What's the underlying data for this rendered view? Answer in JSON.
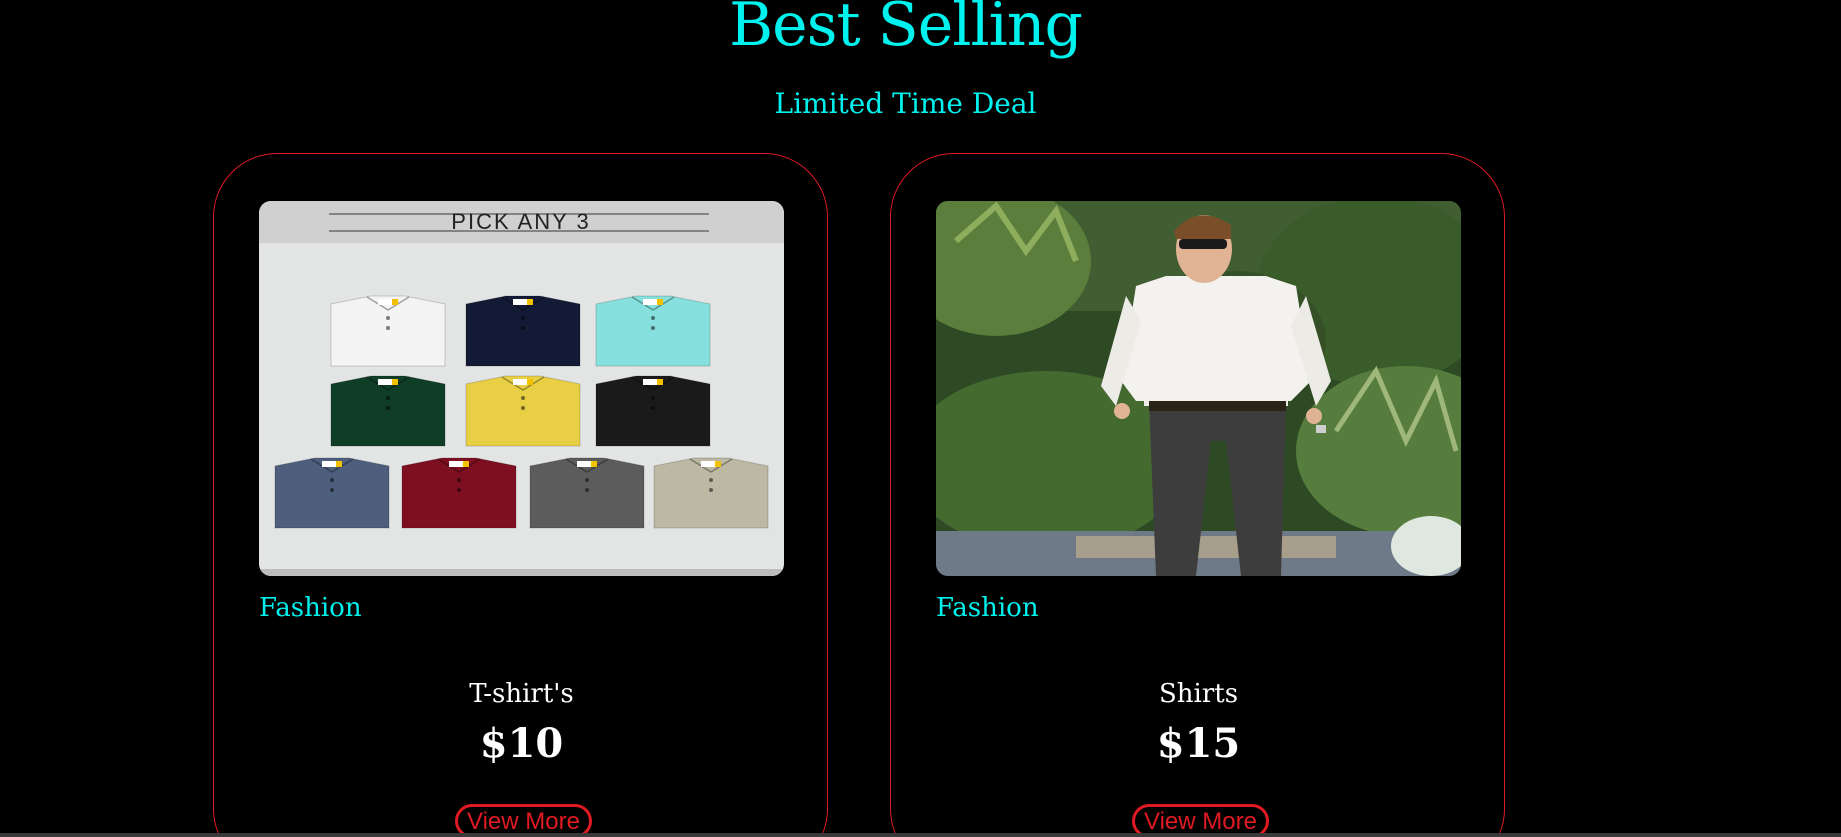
{
  "header": {
    "title": "Best Selling",
    "subtitle": "Limited Time Deal"
  },
  "products": [
    {
      "image_title": "PICK ANY 3",
      "image_alt": "folded polo t-shirts in assorted colors",
      "category": "Fashion",
      "name": "T-shirt's",
      "price": "$10",
      "button_label": "View More"
    },
    {
      "image_alt": "man in white shirt and dark jeans",
      "category": "Fashion",
      "name": "Shirts",
      "price": "$15",
      "button_label": "View More"
    }
  ],
  "colors": {
    "background": "#000000",
    "heading": "#00f2ee",
    "accent": "#e01a22",
    "text": "#ffffff"
  }
}
